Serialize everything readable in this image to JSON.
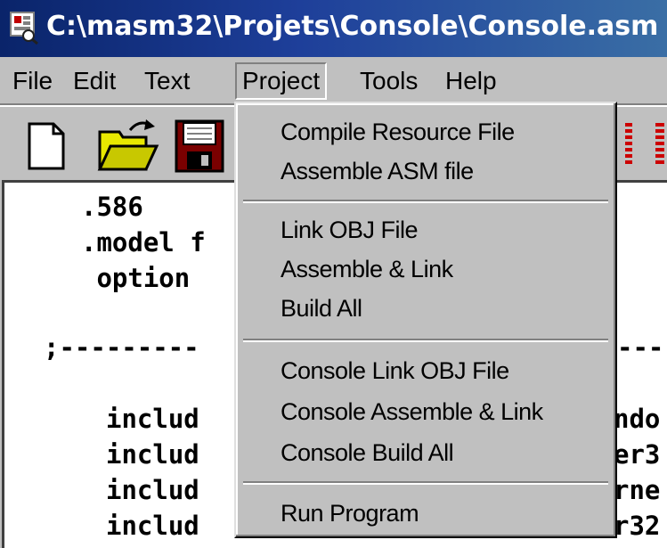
{
  "window": {
    "title": "C:\\masm32\\Projets\\Console\\Console.asm"
  },
  "menubar": {
    "items": [
      {
        "label": "File"
      },
      {
        "label": "Edit"
      },
      {
        "label": "Text"
      },
      {
        "label": "Project"
      },
      {
        "label": "Tools"
      },
      {
        "label": "Help"
      }
    ]
  },
  "toolbar": {
    "icons": [
      "new-file-icon",
      "open-folder-icon",
      "save-disk-icon"
    ]
  },
  "editor": {
    "lines": [
      ".586",
      ".model f",
      " option",
      ";---------",
      "includ",
      "includ",
      "includ",
      "includ"
    ],
    "right_fragments": [
      "-----",
      "ndo",
      "er3",
      "rne",
      "r32"
    ]
  },
  "project_menu": {
    "groups": [
      [
        "Compile Resource File",
        "Assemble ASM file"
      ],
      [
        "Link OBJ File",
        "Assemble & Link",
        "Build All"
      ],
      [
        "Console Link OBJ File",
        "Console Assemble & Link",
        "Console Build All"
      ],
      [
        "Run Program"
      ]
    ]
  },
  "colors": {
    "titlebar_start": "#0a246a",
    "titlebar_end": "#3a6ea5",
    "face": "#c0c0c0",
    "toolbar_red": "#cc0000"
  }
}
